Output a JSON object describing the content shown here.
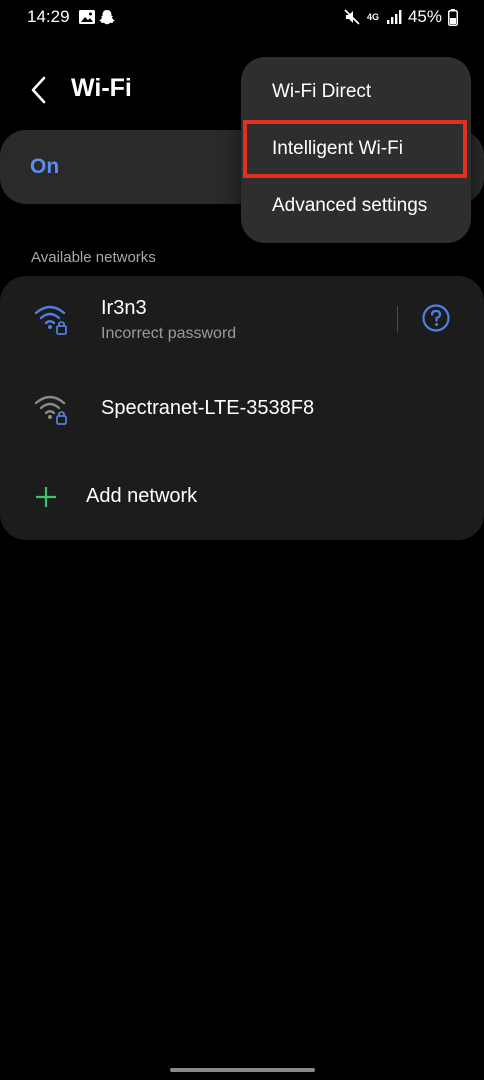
{
  "status_bar": {
    "time": "14:29",
    "left_icons": [
      "gallery-icon",
      "snapchat-icon"
    ],
    "right_icons": [
      "mute-icon",
      "lte-4g-icon",
      "signal-icon",
      "battery-icon"
    ],
    "battery": "45%",
    "network_label": "4G"
  },
  "header": {
    "title": "Wi-Fi"
  },
  "toggle": {
    "label": "On",
    "accent_color": "#5b8def"
  },
  "section": {
    "available_label": "Available networks"
  },
  "networks": [
    {
      "name": "Ir3n3",
      "subtitle": "Incorrect password",
      "icon": "wifi-lock-icon",
      "icon_color": "#4f7fe0",
      "has_help": true
    },
    {
      "name": "Spectranet-LTE-3538F8",
      "subtitle": "",
      "icon": "wifi-lock-icon",
      "icon_color": "#8a8a8a",
      "has_help": false
    }
  ],
  "add_network": {
    "label": "Add network",
    "icon_color": "#3ec46d"
  },
  "menu": {
    "items": [
      {
        "label": "Wi-Fi Direct"
      },
      {
        "label": "Intelligent Wi-Fi",
        "highlighted": true
      },
      {
        "label": "Advanced settings"
      }
    ],
    "highlight_color": "#e0301e"
  }
}
